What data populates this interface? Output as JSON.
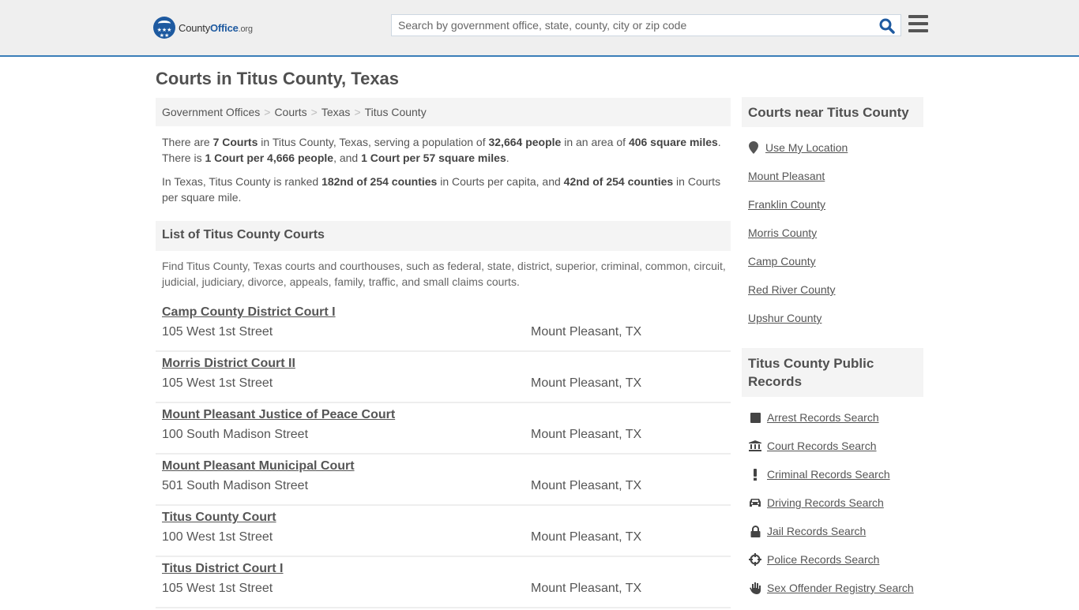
{
  "header": {
    "logo": {
      "county": "County",
      "office": "Office",
      "org": ".org",
      "stars": "★★★ ★★"
    },
    "search_placeholder": "Search by government office, state, county, city or zip code",
    "search_value": ""
  },
  "page_title": "Courts in Titus County, Texas",
  "breadcrumb": [
    {
      "label": "Government Offices"
    },
    {
      "label": "Courts"
    },
    {
      "label": "Texas"
    },
    {
      "label": "Titus County"
    }
  ],
  "breadcrumb_separator": ">",
  "intro": {
    "p1": {
      "t1": "There are ",
      "b1": "7 Courts",
      "t2": " in Titus County, Texas, serving a population of ",
      "b2": "32,664 people",
      "t3": " in an area of ",
      "b3": "406 square miles",
      "t4": ". There is ",
      "b4": "1 Court per 4,666 people",
      "t5": ", and ",
      "b5": "1 Court per 57 square miles",
      "t6": "."
    },
    "p2": {
      "t1": "In Texas, Titus County is ranked ",
      "b1": "182nd of 254 counties",
      "t2": " in Courts per capita, and ",
      "b2": "42nd of 254 counties",
      "t3": " in Courts per square mile."
    }
  },
  "list_section": {
    "title": "List of Titus County Courts",
    "description": "Find Titus County, Texas courts and courthouses, such as federal, state, district, superior, criminal, common, circuit, judicial, judiciary, divorce, appeals, family, traffic, and small claims courts."
  },
  "courts": [
    {
      "name": "Camp County District Court I",
      "address": "105 West 1st Street",
      "city": "Mount Pleasant, TX"
    },
    {
      "name": "Morris District Court II",
      "address": "105 West 1st Street",
      "city": "Mount Pleasant, TX"
    },
    {
      "name": "Mount Pleasant Justice of Peace Court",
      "address": "100 South Madison Street",
      "city": "Mount Pleasant, TX"
    },
    {
      "name": "Mount Pleasant Municipal Court",
      "address": "501 South Madison Street",
      "city": "Mount Pleasant, TX"
    },
    {
      "name": "Titus County Court",
      "address": "100 West 1st Street",
      "city": "Mount Pleasant, TX"
    },
    {
      "name": "Titus District Court I",
      "address": "105 West 1st Street",
      "city": "Mount Pleasant, TX"
    }
  ],
  "sidebar": {
    "nearby": {
      "title": "Courts near Titus County",
      "use_location": {
        "label": "Use My Location",
        "icon": "map-marker-icon"
      },
      "links": [
        "Mount Pleasant",
        "Franklin County",
        "Morris County",
        "Camp County",
        "Red River County",
        "Upshur County"
      ]
    },
    "records": {
      "title": "Titus County Public Records",
      "links": [
        {
          "label": "Arrest Records Search",
          "icon": "square-icon",
          "glyph": "■"
        },
        {
          "label": "Court Records Search",
          "icon": "courthouse-icon",
          "glyph": "🏛"
        },
        {
          "label": "Criminal Records Search",
          "icon": "exclamation-icon",
          "glyph": "!"
        },
        {
          "label": "Driving Records Search",
          "icon": "car-icon",
          "glyph": "🚘"
        },
        {
          "label": "Jail Records Search",
          "icon": "lock-icon",
          "glyph": "🔒"
        },
        {
          "label": "Police Records Search",
          "icon": "crosshairs-icon",
          "glyph": "⌖"
        },
        {
          "label": "Sex Offender Registry Search",
          "icon": "hand-icon",
          "glyph": "✋"
        }
      ]
    }
  },
  "colors": {
    "accent": "#3a7eb8",
    "brand_blue": "#1e5aa0",
    "search_icon": "#1e5aa0",
    "text": "#555555",
    "panel": "#f4f4f4",
    "header_bg": "#efefef"
  }
}
